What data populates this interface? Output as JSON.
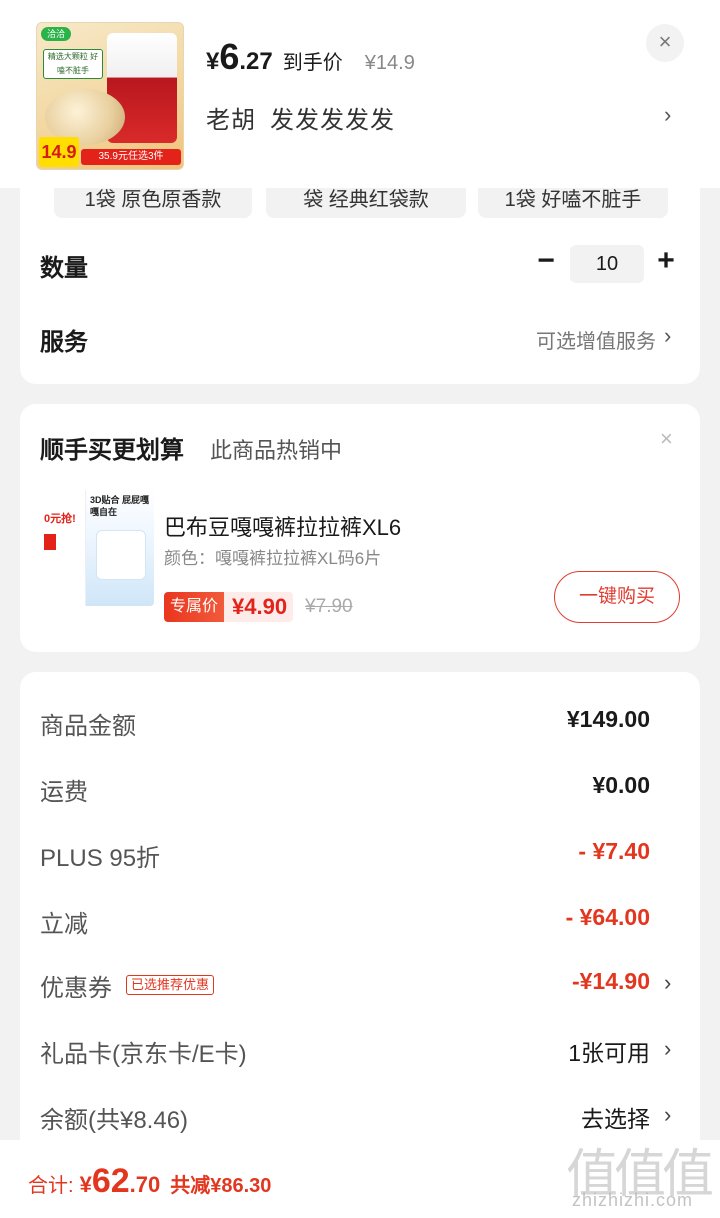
{
  "header": {
    "thumb_brand": "洽洽",
    "thumb_tag": "精选大颗粒 好嗑不脏手",
    "thumb_price": "14.9",
    "thumb_deal": "35.9元任选3件",
    "price_symbol": "¥",
    "price_int": "6",
    "price_dec": ".27",
    "price_note": "到手价",
    "orig_price": "¥14.9",
    "close_icon": "×",
    "spec_name": "老胡",
    "spec_value": "发发发发发",
    "chevron": "›"
  },
  "options": [
    "1袋 原色原香款",
    "袋 经典红袋款",
    "1袋 好嗑不脏手"
  ],
  "quantity": {
    "label": "数量",
    "minus": "−",
    "value": "10",
    "plus": "+"
  },
  "service": {
    "label": "服务",
    "value": "可选增值服务",
    "chevron": "›"
  },
  "upsell": {
    "title": "顺手买更划算",
    "subtitle": "此商品热销中",
    "close_icon": "×",
    "thumb_text_1": "0元抢!",
    "thumb_text_2": "3D贴合 屁屁嘎嘎自在",
    "product_name": "巴布豆嘎嘎裤拉拉裤XL6",
    "variant": "颜色：嘎嘎裤拉拉裤XL码6片",
    "exclusive_label": "专属价",
    "price": "¥4.90",
    "orig_price": "¥7.90",
    "buy_label": "一键购买"
  },
  "summary": {
    "rows": [
      {
        "label": "商品金额",
        "value": "¥149.00"
      },
      {
        "label": "运费",
        "value": "¥0.00"
      },
      {
        "label": "PLUS 95折",
        "value": "- ¥7.40"
      },
      {
        "label": "立减",
        "value": "- ¥64.00"
      },
      {
        "label": "优惠券",
        "tag": "已选推荐优惠",
        "value": "-¥14.90",
        "chevron": "›"
      },
      {
        "label": "礼品卡(京东卡/E卡)",
        "value": "1张可用",
        "chevron": "›"
      },
      {
        "label": "余额(共¥8.46)",
        "value": "去选择",
        "chevron": "›"
      }
    ]
  },
  "bottom": {
    "total_label": "合计:",
    "total_symbol": "¥",
    "total_int": "62",
    "total_dec": ".70",
    "saved": "共减¥86.30"
  },
  "watermark": {
    "glyphs": [
      "值",
      "值",
      "值"
    ],
    "text": "zhizhizhi.com"
  },
  "colors": {
    "accent_red": "#e2361f",
    "background": "#f2f2f2",
    "card": "#ffffff"
  }
}
